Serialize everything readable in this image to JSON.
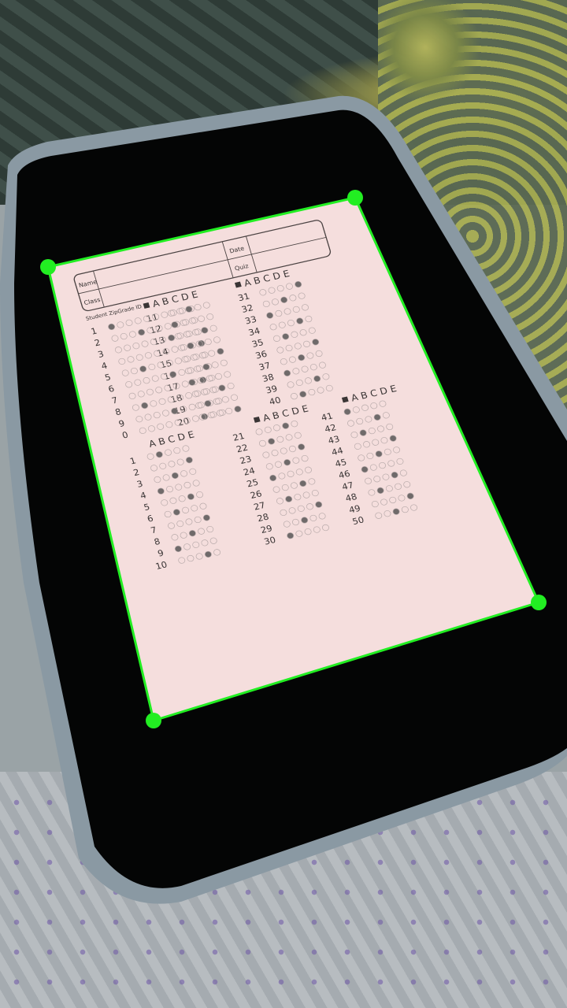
{
  "form": {
    "name_label": "Name",
    "class_label": "Class",
    "date_label": "Date",
    "quiz_label": "Quiz",
    "brand": "Student ZipGrade ID",
    "columns_label": "A B C D E"
  },
  "block_id_rows": [
    "1",
    "2",
    "3",
    "4",
    "5",
    "6",
    "7",
    "8",
    "9",
    "0"
  ],
  "block_q11": [
    "11",
    "12",
    "13",
    "14",
    "15",
    "16",
    "17",
    "18",
    "19",
    "20"
  ],
  "block_q31": [
    "31",
    "32",
    "33",
    "34",
    "35",
    "36",
    "37",
    "38",
    "39",
    "40"
  ],
  "block_q1": [
    "1",
    "2",
    "3",
    "4",
    "5",
    "6",
    "7",
    "8",
    "9",
    "10"
  ],
  "block_q21": [
    "21",
    "22",
    "23",
    "24",
    "25",
    "26",
    "27",
    "28",
    "29",
    "30"
  ],
  "block_q41": [
    "41",
    "42",
    "43",
    "44",
    "45",
    "46",
    "47",
    "48",
    "49",
    "50"
  ],
  "colors": {
    "corner_marker": "#22ee22",
    "border_line": "#22ee22",
    "paper": "#f5dedd",
    "tray": "#050606"
  }
}
